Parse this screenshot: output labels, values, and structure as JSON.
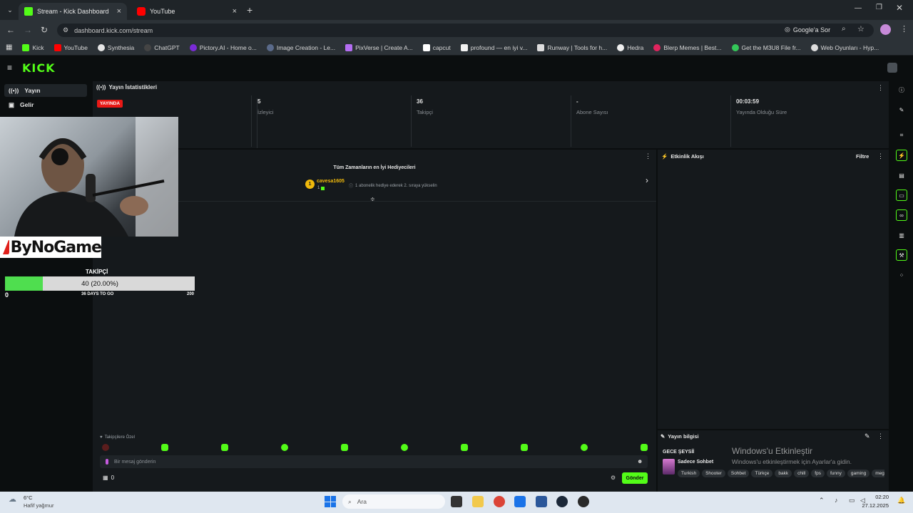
{
  "browser": {
    "tabs": [
      {
        "title": "Stream - Kick Dashboard",
        "icon": "kick-icon",
        "active": true
      },
      {
        "title": "YouTube",
        "icon": "youtube-icon",
        "active": false
      }
    ],
    "url": "dashboard.kick.com/stream",
    "google_lens_label": "Google'a Sor",
    "bookmarks": [
      "Kick",
      "YouTube",
      "Synthesia",
      "ChatGPT",
      "Pictory.AI - Home o...",
      "Image Creation - Le...",
      "PixVerse | Create A...",
      "capcut",
      "profound — en iyi v...",
      "Runway | Tools for h...",
      "Hedra",
      "Blerp Memes | Best...",
      "Get the M3U8 File fr...",
      "Web Oyunları - Hyp..."
    ]
  },
  "kick": {
    "logo": "KICK",
    "sidebar": [
      {
        "label": "Yayın",
        "icon": "broadcast-icon",
        "active": true
      },
      {
        "label": "Gelir",
        "icon": "revenue-icon",
        "active": false
      }
    ],
    "stats": {
      "title": "Yayın İstatistikleri",
      "live_badge": "YAYINDA",
      "cells": [
        {
          "value": "5",
          "label": "İzleyici"
        },
        {
          "value": "36",
          "label": "Takipçi"
        },
        {
          "value": "-",
          "label": "Abone Sayısı"
        },
        {
          "value": "00:03:59",
          "label": "Yayında Olduğu Süre"
        }
      ]
    },
    "gifters": {
      "title": "Tüm Zamanların en İyi Hediyecileri",
      "rank": "1",
      "user": "cavesa1605",
      "count": "1",
      "hint": "1 abonelik hediye ederek 2. sıraya yükselin"
    },
    "chat": {
      "followers_only": "Takipçilere Özel",
      "placeholder": "Bir mesaj gönderin",
      "count": "0",
      "send": "Gönder"
    },
    "activity": {
      "title": "Etkinlik Akışı",
      "filter": "Filtre"
    },
    "stream_info": {
      "title": "Yayın bilgisi",
      "stream_title": "GECE ŞEYSİİ",
      "category": "Sadece Sohbet",
      "tags": [
        "Turkish",
        "Shooter",
        "Sohbet",
        "Türkçe",
        "bakk",
        "chill",
        "fps",
        "funny",
        "gaming",
        "megab"
      ]
    }
  },
  "overlay": {
    "brand": "ByNoGame",
    "goal_label": "TAKİPÇİ",
    "goal_text": "40 (20.00%)",
    "goal_fraction": 0.2,
    "goal_min": "0",
    "goal_max": "200",
    "goal_days": "36 DAYS TO GO"
  },
  "watermark": {
    "line1": "Windows'u Etkinleştir",
    "line2": "Windows'u etkinleştirmek için Ayarlar'a gidin."
  },
  "taskbar": {
    "temp": "6°C",
    "weather": "Hafif yağmur",
    "search": "Ara",
    "time": "02:20",
    "date": "27.12.2025"
  }
}
